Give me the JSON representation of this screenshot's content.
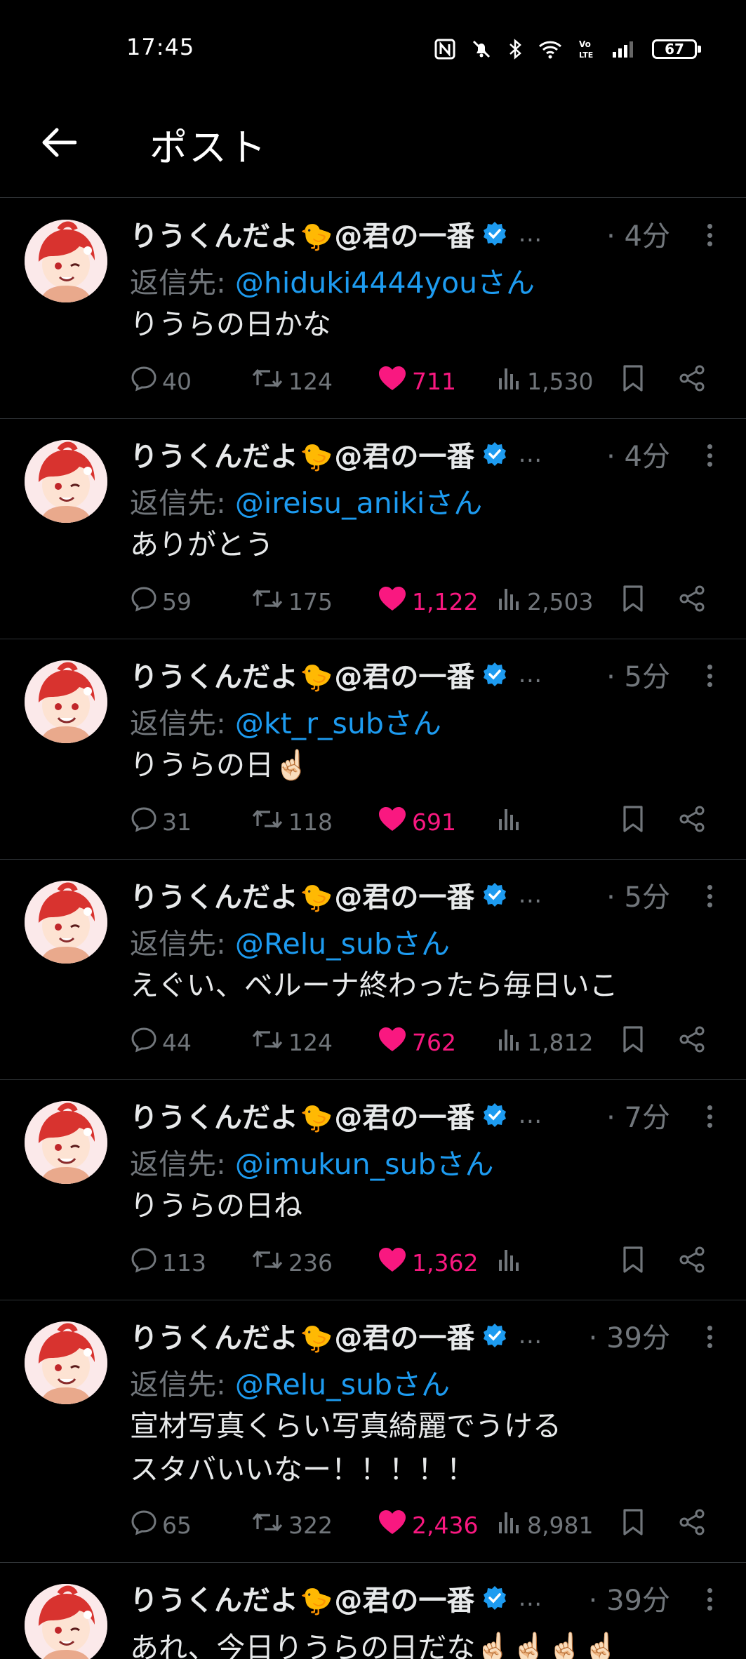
{
  "status_bar": {
    "time": "17:45",
    "battery": "67"
  },
  "header": {
    "title": "ポスト"
  },
  "reply_prefix": "返信先: ",
  "user": {
    "name": "りうくんだよ",
    "emoji": "🐤",
    "suffix": "@君の一番",
    "ellipsis": "…"
  },
  "posts": [
    {
      "time": "· 4分",
      "reply_to": "@hiduki4444youさん",
      "text": "りうらの日かな",
      "comments": "40",
      "retweets": "124",
      "likes": "711",
      "views": "1,530"
    },
    {
      "time": "· 4分",
      "reply_to": "@ireisu_anikiさん",
      "text": "ありがとう",
      "comments": "59",
      "retweets": "175",
      "likes": "1,122",
      "views": "2,503"
    },
    {
      "time": "· 5分",
      "reply_to": "@kt_r_subさん",
      "text": "りうらの日☝🏻",
      "comments": "31",
      "retweets": "118",
      "likes": "691",
      "views": ""
    },
    {
      "time": "· 5分",
      "reply_to": "@Relu_subさん",
      "text": "えぐい、ベルーナ終わったら毎日いこ",
      "comments": "44",
      "retweets": "124",
      "likes": "762",
      "views": "1,812"
    },
    {
      "time": "· 7分",
      "reply_to": "@imukun_subさん",
      "text": "りうらの日ね",
      "comments": "113",
      "retweets": "236",
      "likes": "1,362",
      "views": ""
    },
    {
      "time": "· 39分",
      "reply_to": "@Relu_subさん",
      "text": "宣材写真くらい写真綺麗でうける\nスタバいいなー！！！！！",
      "comments": "65",
      "retweets": "322",
      "likes": "2,436",
      "views": "8,981"
    },
    {
      "time": "· 39分",
      "text": "あれ、今日りうらの日だな☝🏻☝🏻☝🏻☝🏻"
    }
  ],
  "colors": {
    "link": "#1d9bf0",
    "like": "#f91880",
    "muted": "#71767b",
    "verified": "#1d9bf0"
  },
  "icons": [
    "back-arrow-icon",
    "nfc-icon",
    "mute-icon",
    "bluetooth-icon",
    "wifi-icon",
    "volte-icon",
    "signal-icon",
    "verified-badge-icon",
    "more-vertical-icon",
    "comment-icon",
    "retweet-icon",
    "heart-icon",
    "views-icon",
    "bookmark-icon",
    "share-icon"
  ]
}
